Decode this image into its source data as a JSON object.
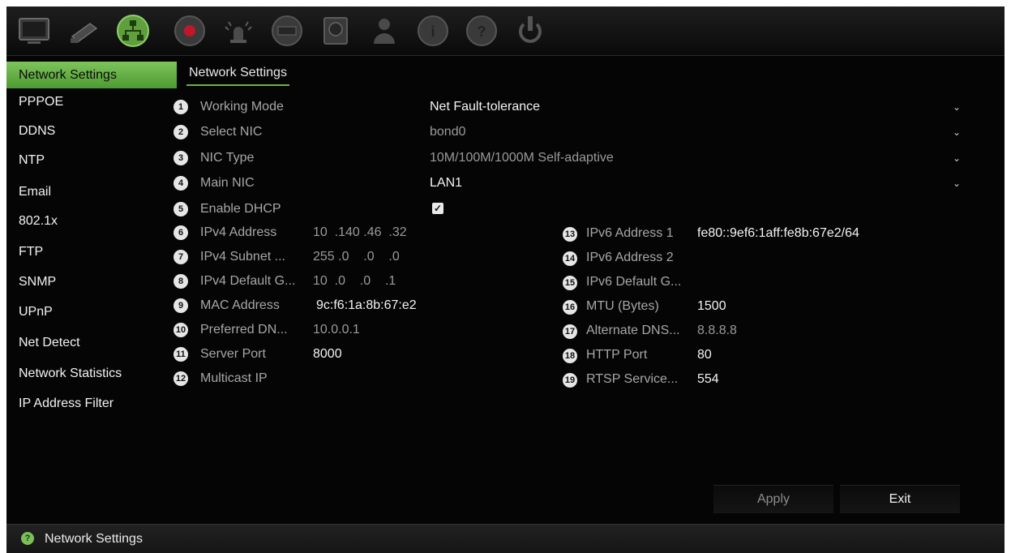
{
  "toolbar": {
    "icons": [
      "monitor-icon",
      "camera-icon",
      "network-icon",
      "record-icon",
      "alarm-icon",
      "device-icon",
      "storage-icon",
      "user-icon",
      "system-info-icon",
      "help-icon",
      "power-icon"
    ],
    "active": "network-icon"
  },
  "sidebar": {
    "items": [
      {
        "label": "Network Settings",
        "active": true
      },
      {
        "label": "PPPOE"
      },
      {
        "label": "DDNS"
      },
      {
        "label": "NTP"
      },
      {
        "label": "Email"
      },
      {
        "label": "802.1x"
      },
      {
        "label": "FTP"
      },
      {
        "label": "SNMP"
      },
      {
        "label": "UPnP"
      },
      {
        "label": "Net Detect"
      },
      {
        "label": "Network Statistics"
      },
      {
        "label": "IP Address Filter"
      }
    ]
  },
  "tab": {
    "label": "Network Settings"
  },
  "form": {
    "rows": [
      {
        "num": "1",
        "label": "Working Mode",
        "value": "Net Fault-tolerance"
      },
      {
        "num": "2",
        "label": "Select NIC",
        "value": "bond0"
      },
      {
        "num": "3",
        "label": "NIC Type",
        "value": "10M/100M/1000M Self-adaptive"
      },
      {
        "num": "4",
        "label": "Main NIC",
        "value": "LAN1"
      },
      {
        "num": "5",
        "label": "Enable DHCP",
        "checked": true
      },
      {
        "num": "6",
        "label": "IPv4 Address",
        "value": "10  .140 .46  .32"
      },
      {
        "num": "7",
        "label": "IPv4 Subnet ...",
        "value": "255 .0    .0    .0"
      },
      {
        "num": "8",
        "label": "IPv4 Default G...",
        "value": "10  .0    .0    .1"
      },
      {
        "num": "9",
        "label": "MAC Address",
        "value": "9c:f6:1a:8b:67:e2"
      },
      {
        "num": "10",
        "label": "Preferred DN...",
        "value": "10.0.0.1"
      },
      {
        "num": "11",
        "label": "Server Port",
        "value": "8000"
      },
      {
        "num": "12",
        "label": "Multicast IP",
        "value": ""
      }
    ],
    "right_rows": [
      {
        "num": "13",
        "label": "IPv6 Address 1",
        "value": "fe80::9ef6:1aff:fe8b:67e2/64"
      },
      {
        "num": "14",
        "label": "IPv6 Address 2",
        "value": ""
      },
      {
        "num": "15",
        "label": "IPv6 Default G...",
        "value": ""
      },
      {
        "num": "16",
        "label": "MTU (Bytes)",
        "value": "1500"
      },
      {
        "num": "17",
        "label": "Alternate DNS...",
        "value": "8.8.8.8"
      },
      {
        "num": "18",
        "label": "HTTP Port",
        "value": "80"
      },
      {
        "num": "19",
        "label": "RTSP Service...",
        "value": "554"
      }
    ]
  },
  "buttons": {
    "apply": "Apply",
    "exit": "Exit"
  },
  "statusbar": {
    "text": "Network Settings",
    "icon": "help-icon"
  },
  "colors": {
    "accent": "#6fb04a",
    "background": "#050505"
  }
}
